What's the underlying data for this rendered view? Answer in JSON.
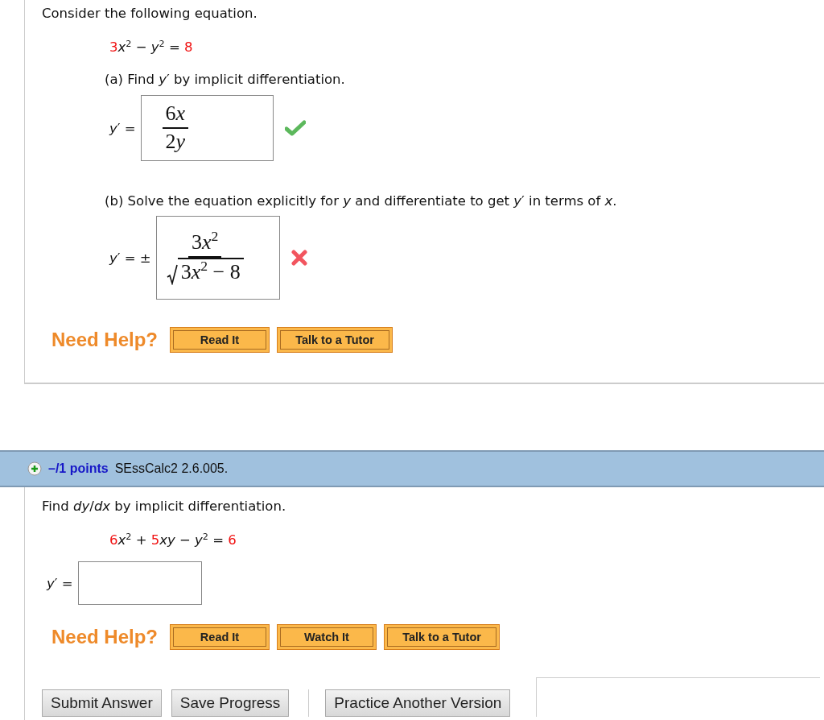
{
  "question1": {
    "prompt": "Consider the following equation.",
    "equation": [
      {
        "text": "3",
        "given": true
      },
      {
        "text": "*x*$^{2}$ − *y*$^{2}$ = ",
        "given": false
      },
      {
        "text": "8",
        "given": true
      }
    ],
    "parts": [
      {
        "prompt": "(a) Find  *y*′  by implicit differentiation.",
        "lhs": "*y*′ =",
        "answer": {
          "kind": "fraction",
          "numerator": [
            "6",
            "*x*"
          ],
          "denominator": [
            "2",
            "*y*"
          ]
        },
        "correct": true
      },
      {
        "prompt": "(b) Solve the equation explicitly for *y* and differentiate to get  *y*′  in terms of *x*.",
        "lhs": "*y*′ = ±",
        "answer": {
          "kind": "sqrt_fraction",
          "numerator": [
            "3",
            "*x*$^{2}$"
          ],
          "denominator": [
            "3",
            "*x*$^{2}$",
            " − 8"
          ]
        },
        "correct": false
      }
    ],
    "help": {
      "label": "Need Help?",
      "buttons": [
        "Read It",
        "Talk to a Tutor"
      ]
    }
  },
  "question2": {
    "header": {
      "points": "–/1 points",
      "code": "SEssCalc2 2.6.005."
    },
    "prompt": "Find *dy*/*dx* by implicit differentiation.",
    "equation": [
      {
        "text": "6",
        "given": true
      },
      {
        "text": "*x*$^{2}$ + ",
        "given": false
      },
      {
        "text": "5",
        "given": true
      },
      {
        "text": "*xy* − *y*$^{2}$ = ",
        "given": false
      },
      {
        "text": "6",
        "given": true
      }
    ],
    "lhs": "*y*′ =",
    "help": {
      "label": "Need Help?",
      "buttons": [
        "Read It",
        "Watch It",
        "Talk to a Tutor"
      ]
    }
  },
  "actions": [
    "Submit Answer",
    "Save Progress",
    "Practice Another Version"
  ]
}
